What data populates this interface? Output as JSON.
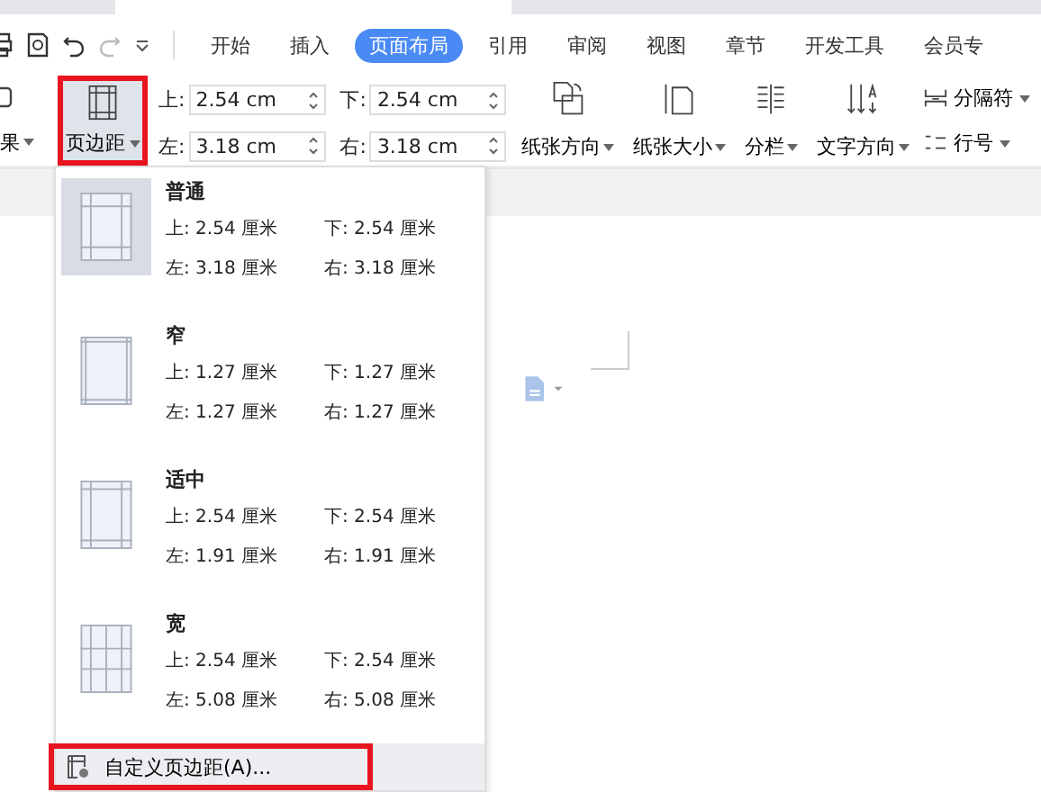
{
  "menu_tabs": [
    {
      "label": "开始",
      "selected": false
    },
    {
      "label": "插入",
      "selected": false
    },
    {
      "label": "页面布局",
      "selected": true
    },
    {
      "label": "引用",
      "selected": false
    },
    {
      "label": "审阅",
      "selected": false
    },
    {
      "label": "视图",
      "selected": false
    },
    {
      "label": "章节",
      "selected": false
    },
    {
      "label": "开发工具",
      "selected": false
    },
    {
      "label": "会员专",
      "selected": false
    }
  ],
  "ribbon": {
    "cut_label": "果",
    "margins_button": {
      "label": "页边距",
      "highlighted": true
    },
    "fields": [
      {
        "label": "上:",
        "value": "2.54 cm"
      },
      {
        "label": "下:",
        "value": "2.54 cm"
      },
      {
        "label": "左:",
        "value": "3.18 cm"
      },
      {
        "label": "右:",
        "value": "3.18 cm"
      }
    ],
    "buttons": [
      {
        "label": "纸张方向",
        "kind": "orientation"
      },
      {
        "label": "纸张大小",
        "kind": "size"
      },
      {
        "label": "分栏",
        "kind": "columns"
      },
      {
        "label": "文字方向",
        "kind": "direction"
      }
    ],
    "small_buttons": [
      {
        "label": "分隔符",
        "kind": "break"
      },
      {
        "label": "行号",
        "kind": "lines"
      }
    ]
  },
  "margins_menu": {
    "presets": [
      {
        "name": "普通",
        "top": "上: 2.54 厘米",
        "bottom": "下: 2.54 厘米",
        "left": "左: 3.18 厘米",
        "right": "右: 3.18 厘米",
        "selected": true,
        "kind": "normal"
      },
      {
        "name": "窄",
        "top": "上: 1.27 厘米",
        "bottom": "下: 1.27 厘米",
        "left": "左: 1.27 厘米",
        "right": "右: 1.27 厘米",
        "selected": false,
        "kind": "narrow"
      },
      {
        "name": "适中",
        "top": "上: 2.54 厘米",
        "bottom": "下: 2.54 厘米",
        "left": "左: 1.91 厘米",
        "right": "右: 1.91 厘米",
        "selected": false,
        "kind": "moderate"
      },
      {
        "name": "宽",
        "top": "上: 2.54 厘米",
        "bottom": "下: 2.54 厘米",
        "left": "左: 5.08 厘米",
        "right": "右: 5.08 厘米",
        "selected": false,
        "kind": "wide"
      }
    ],
    "custom": {
      "label": "自定义页边距(A)...",
      "highlighted": true
    }
  }
}
